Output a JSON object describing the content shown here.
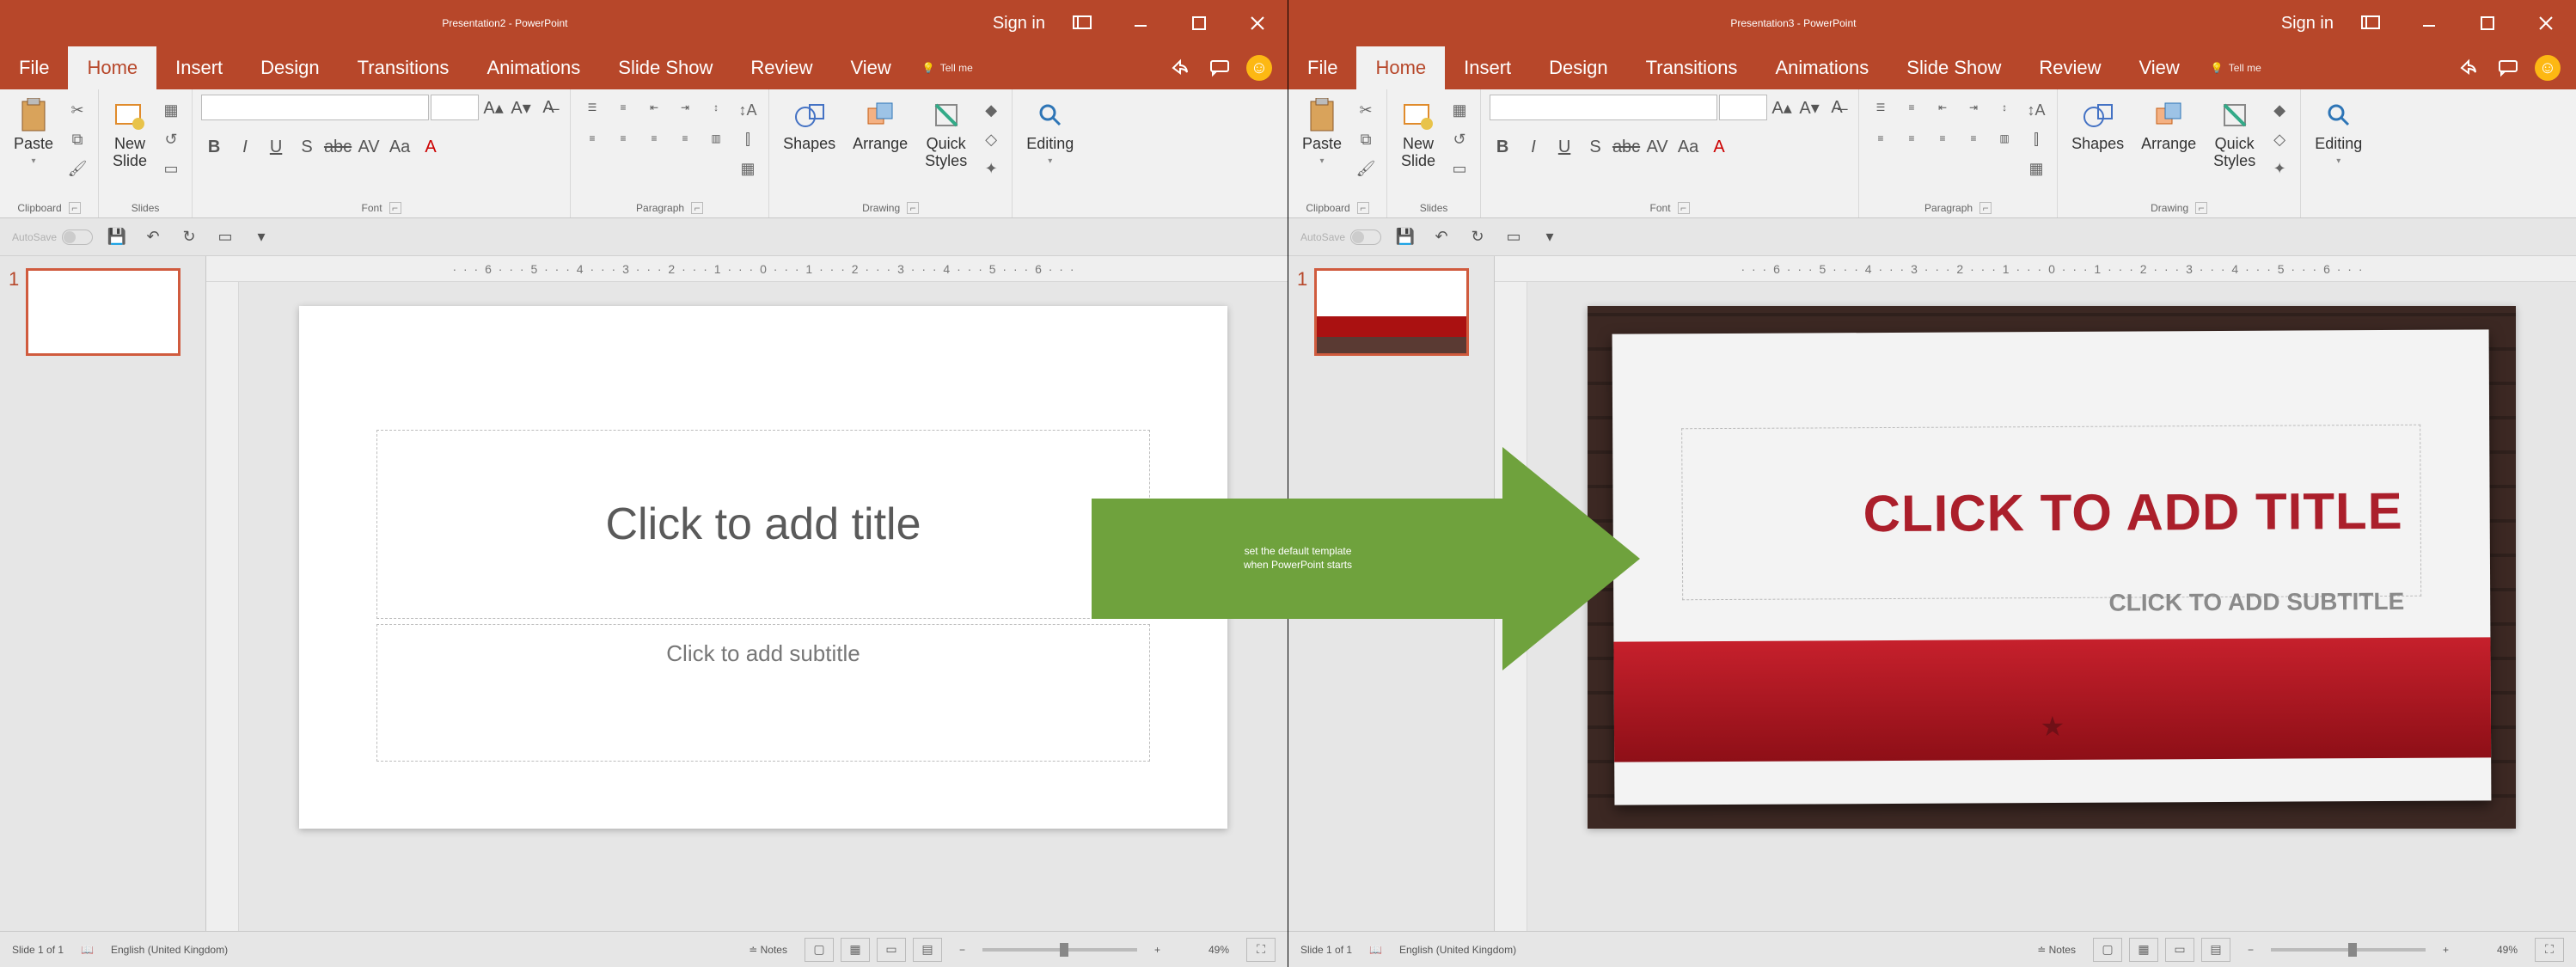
{
  "arrow": {
    "line1": "set the default template",
    "line2": "when PowerPoint starts"
  },
  "left": {
    "title": "Presentation2  -  PowerPoint",
    "signin": "Sign in",
    "tabs": {
      "file": "File",
      "home": "Home",
      "insert": "Insert",
      "design": "Design",
      "transitions": "Transitions",
      "animations": "Animations",
      "slideshow": "Slide Show",
      "review": "Review",
      "view": "View",
      "tellme": "Tell me"
    },
    "ribbon": {
      "clipboard": {
        "paste": "Paste",
        "label": "Clipboard"
      },
      "slides": {
        "newslide": "New\nSlide",
        "label": "Slides"
      },
      "font": {
        "label": "Font"
      },
      "paragraph": {
        "label": "Paragraph"
      },
      "drawing": {
        "shapes": "Shapes",
        "arrange": "Arrange",
        "quick": "Quick\nStyles",
        "label": "Drawing"
      },
      "editing": {
        "label": "Editing"
      }
    },
    "autosave": "AutoSave",
    "slide": {
      "num": "1",
      "title_ph": "Click to add title",
      "sub_ph": "Click to add subtitle"
    },
    "status": {
      "slide": "Slide 1 of 1",
      "lang": "English (United Kingdom)",
      "notes": "Notes",
      "zoom": "49%"
    }
  },
  "right": {
    "title": "Presentation3  -  PowerPoint",
    "signin": "Sign in",
    "tabs": {
      "file": "File",
      "home": "Home",
      "insert": "Insert",
      "design": "Design",
      "transitions": "Transitions",
      "animations": "Animations",
      "slideshow": "Slide Show",
      "review": "Review",
      "view": "View",
      "tellme": "Tell me"
    },
    "ribbon": {
      "clipboard": {
        "paste": "Paste",
        "label": "Clipboard"
      },
      "slides": {
        "newslide": "New\nSlide",
        "label": "Slides"
      },
      "font": {
        "label": "Font"
      },
      "paragraph": {
        "label": "Paragraph"
      },
      "drawing": {
        "shapes": "Shapes",
        "arrange": "Arrange",
        "quick": "Quick\nStyles",
        "label": "Drawing"
      },
      "editing": {
        "label": "Editing"
      }
    },
    "autosave": "AutoSave",
    "slide": {
      "num": "1",
      "title_ph": "CLICK TO ADD TITLE",
      "sub_ph": "CLICK TO ADD SUBTITLE"
    },
    "status": {
      "slide": "Slide 1 of 1",
      "lang": "English (United Kingdom)",
      "notes": "Notes",
      "zoom": "49%"
    }
  }
}
